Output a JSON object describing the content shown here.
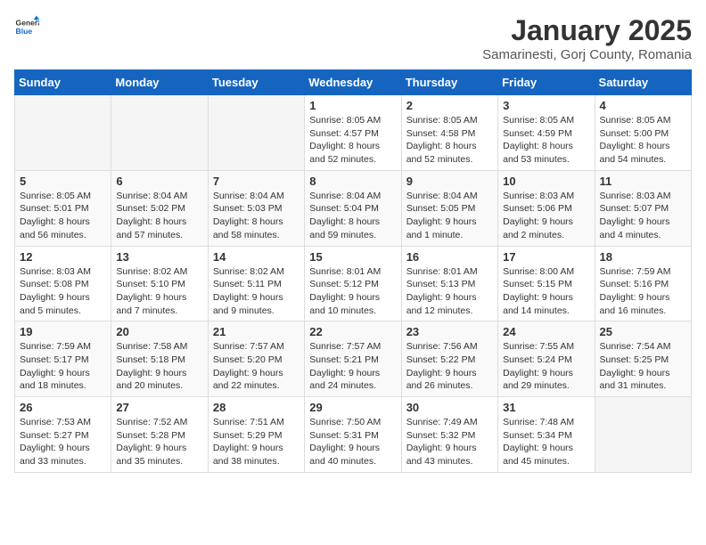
{
  "header": {
    "logo_general": "General",
    "logo_blue": "Blue",
    "title": "January 2025",
    "subtitle": "Samarinesti, Gorj County, Romania"
  },
  "weekdays": [
    "Sunday",
    "Monday",
    "Tuesday",
    "Wednesday",
    "Thursday",
    "Friday",
    "Saturday"
  ],
  "weeks": [
    [
      {
        "day": "",
        "info": ""
      },
      {
        "day": "",
        "info": ""
      },
      {
        "day": "",
        "info": ""
      },
      {
        "day": "1",
        "info": "Sunrise: 8:05 AM\nSunset: 4:57 PM\nDaylight: 8 hours\nand 52 minutes."
      },
      {
        "day": "2",
        "info": "Sunrise: 8:05 AM\nSunset: 4:58 PM\nDaylight: 8 hours\nand 52 minutes."
      },
      {
        "day": "3",
        "info": "Sunrise: 8:05 AM\nSunset: 4:59 PM\nDaylight: 8 hours\nand 53 minutes."
      },
      {
        "day": "4",
        "info": "Sunrise: 8:05 AM\nSunset: 5:00 PM\nDaylight: 8 hours\nand 54 minutes."
      }
    ],
    [
      {
        "day": "5",
        "info": "Sunrise: 8:05 AM\nSunset: 5:01 PM\nDaylight: 8 hours\nand 56 minutes."
      },
      {
        "day": "6",
        "info": "Sunrise: 8:04 AM\nSunset: 5:02 PM\nDaylight: 8 hours\nand 57 minutes."
      },
      {
        "day": "7",
        "info": "Sunrise: 8:04 AM\nSunset: 5:03 PM\nDaylight: 8 hours\nand 58 minutes."
      },
      {
        "day": "8",
        "info": "Sunrise: 8:04 AM\nSunset: 5:04 PM\nDaylight: 8 hours\nand 59 minutes."
      },
      {
        "day": "9",
        "info": "Sunrise: 8:04 AM\nSunset: 5:05 PM\nDaylight: 9 hours\nand 1 minute."
      },
      {
        "day": "10",
        "info": "Sunrise: 8:03 AM\nSunset: 5:06 PM\nDaylight: 9 hours\nand 2 minutes."
      },
      {
        "day": "11",
        "info": "Sunrise: 8:03 AM\nSunset: 5:07 PM\nDaylight: 9 hours\nand 4 minutes."
      }
    ],
    [
      {
        "day": "12",
        "info": "Sunrise: 8:03 AM\nSunset: 5:08 PM\nDaylight: 9 hours\nand 5 minutes."
      },
      {
        "day": "13",
        "info": "Sunrise: 8:02 AM\nSunset: 5:10 PM\nDaylight: 9 hours\nand 7 minutes."
      },
      {
        "day": "14",
        "info": "Sunrise: 8:02 AM\nSunset: 5:11 PM\nDaylight: 9 hours\nand 9 minutes."
      },
      {
        "day": "15",
        "info": "Sunrise: 8:01 AM\nSunset: 5:12 PM\nDaylight: 9 hours\nand 10 minutes."
      },
      {
        "day": "16",
        "info": "Sunrise: 8:01 AM\nSunset: 5:13 PM\nDaylight: 9 hours\nand 12 minutes."
      },
      {
        "day": "17",
        "info": "Sunrise: 8:00 AM\nSunset: 5:15 PM\nDaylight: 9 hours\nand 14 minutes."
      },
      {
        "day": "18",
        "info": "Sunrise: 7:59 AM\nSunset: 5:16 PM\nDaylight: 9 hours\nand 16 minutes."
      }
    ],
    [
      {
        "day": "19",
        "info": "Sunrise: 7:59 AM\nSunset: 5:17 PM\nDaylight: 9 hours\nand 18 minutes."
      },
      {
        "day": "20",
        "info": "Sunrise: 7:58 AM\nSunset: 5:18 PM\nDaylight: 9 hours\nand 20 minutes."
      },
      {
        "day": "21",
        "info": "Sunrise: 7:57 AM\nSunset: 5:20 PM\nDaylight: 9 hours\nand 22 minutes."
      },
      {
        "day": "22",
        "info": "Sunrise: 7:57 AM\nSunset: 5:21 PM\nDaylight: 9 hours\nand 24 minutes."
      },
      {
        "day": "23",
        "info": "Sunrise: 7:56 AM\nSunset: 5:22 PM\nDaylight: 9 hours\nand 26 minutes."
      },
      {
        "day": "24",
        "info": "Sunrise: 7:55 AM\nSunset: 5:24 PM\nDaylight: 9 hours\nand 29 minutes."
      },
      {
        "day": "25",
        "info": "Sunrise: 7:54 AM\nSunset: 5:25 PM\nDaylight: 9 hours\nand 31 minutes."
      }
    ],
    [
      {
        "day": "26",
        "info": "Sunrise: 7:53 AM\nSunset: 5:27 PM\nDaylight: 9 hours\nand 33 minutes."
      },
      {
        "day": "27",
        "info": "Sunrise: 7:52 AM\nSunset: 5:28 PM\nDaylight: 9 hours\nand 35 minutes."
      },
      {
        "day": "28",
        "info": "Sunrise: 7:51 AM\nSunset: 5:29 PM\nDaylight: 9 hours\nand 38 minutes."
      },
      {
        "day": "29",
        "info": "Sunrise: 7:50 AM\nSunset: 5:31 PM\nDaylight: 9 hours\nand 40 minutes."
      },
      {
        "day": "30",
        "info": "Sunrise: 7:49 AM\nSunset: 5:32 PM\nDaylight: 9 hours\nand 43 minutes."
      },
      {
        "day": "31",
        "info": "Sunrise: 7:48 AM\nSunset: 5:34 PM\nDaylight: 9 hours\nand 45 minutes."
      },
      {
        "day": "",
        "info": ""
      }
    ]
  ]
}
